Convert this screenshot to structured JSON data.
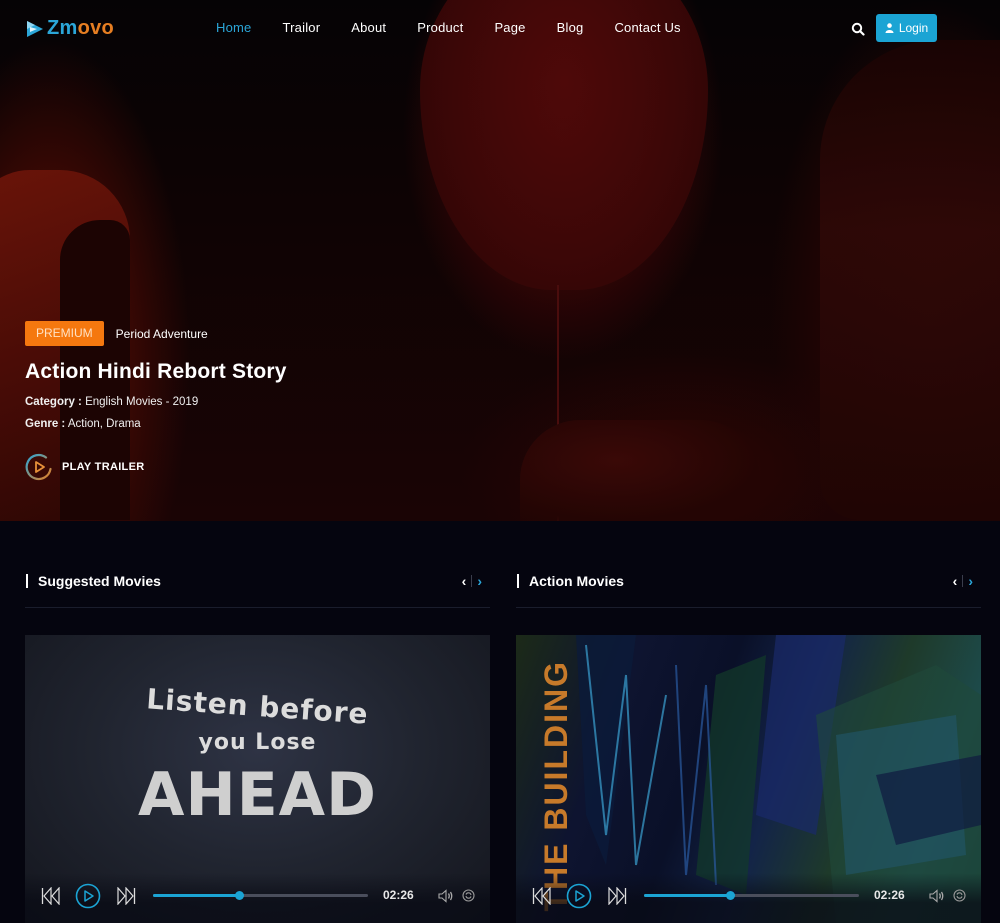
{
  "brand": {
    "logo_part1": "Zm",
    "logo_part2": "ovo",
    "accent_color": "#2ba6d8",
    "secondary_color": "#e67e22"
  },
  "nav": {
    "items": [
      {
        "label": "Home",
        "active": true
      },
      {
        "label": "Trailor",
        "active": false
      },
      {
        "label": "About",
        "active": false
      },
      {
        "label": "Product",
        "active": false
      },
      {
        "label": "Page",
        "active": false
      },
      {
        "label": "Blog",
        "active": false
      },
      {
        "label": "Contact Us",
        "active": false
      }
    ],
    "search_icon": "search-icon",
    "login_label": "Login",
    "login_icon": "user-icon"
  },
  "hero": {
    "badge": "PREMIUM",
    "badge_color": "#f5780f",
    "genre_tag": "Period Adventure",
    "title": "Action Hindi Rebort Story",
    "category_label": "Category :",
    "category_value": "English Movies - 2019",
    "genre_label": "Genre :",
    "genre_value": "Action, Drama",
    "play_trailer_label": "PLAY TRAILER"
  },
  "sections": [
    {
      "title": "Suggested Movies",
      "prev_icon": "chevron-left-icon",
      "next_icon": "chevron-right-icon",
      "player": {
        "thumbnail_text": [
          "Listen before",
          "you Lose",
          "AHEAD"
        ],
        "time": "02:26",
        "progress_percent": 40
      }
    },
    {
      "title": "Action Movies",
      "prev_icon": "chevron-left-icon",
      "next_icon": "chevron-right-icon",
      "player": {
        "thumbnail_text": [
          "THE BUILDING"
        ],
        "time": "02:26",
        "progress_percent": 40
      }
    }
  ]
}
